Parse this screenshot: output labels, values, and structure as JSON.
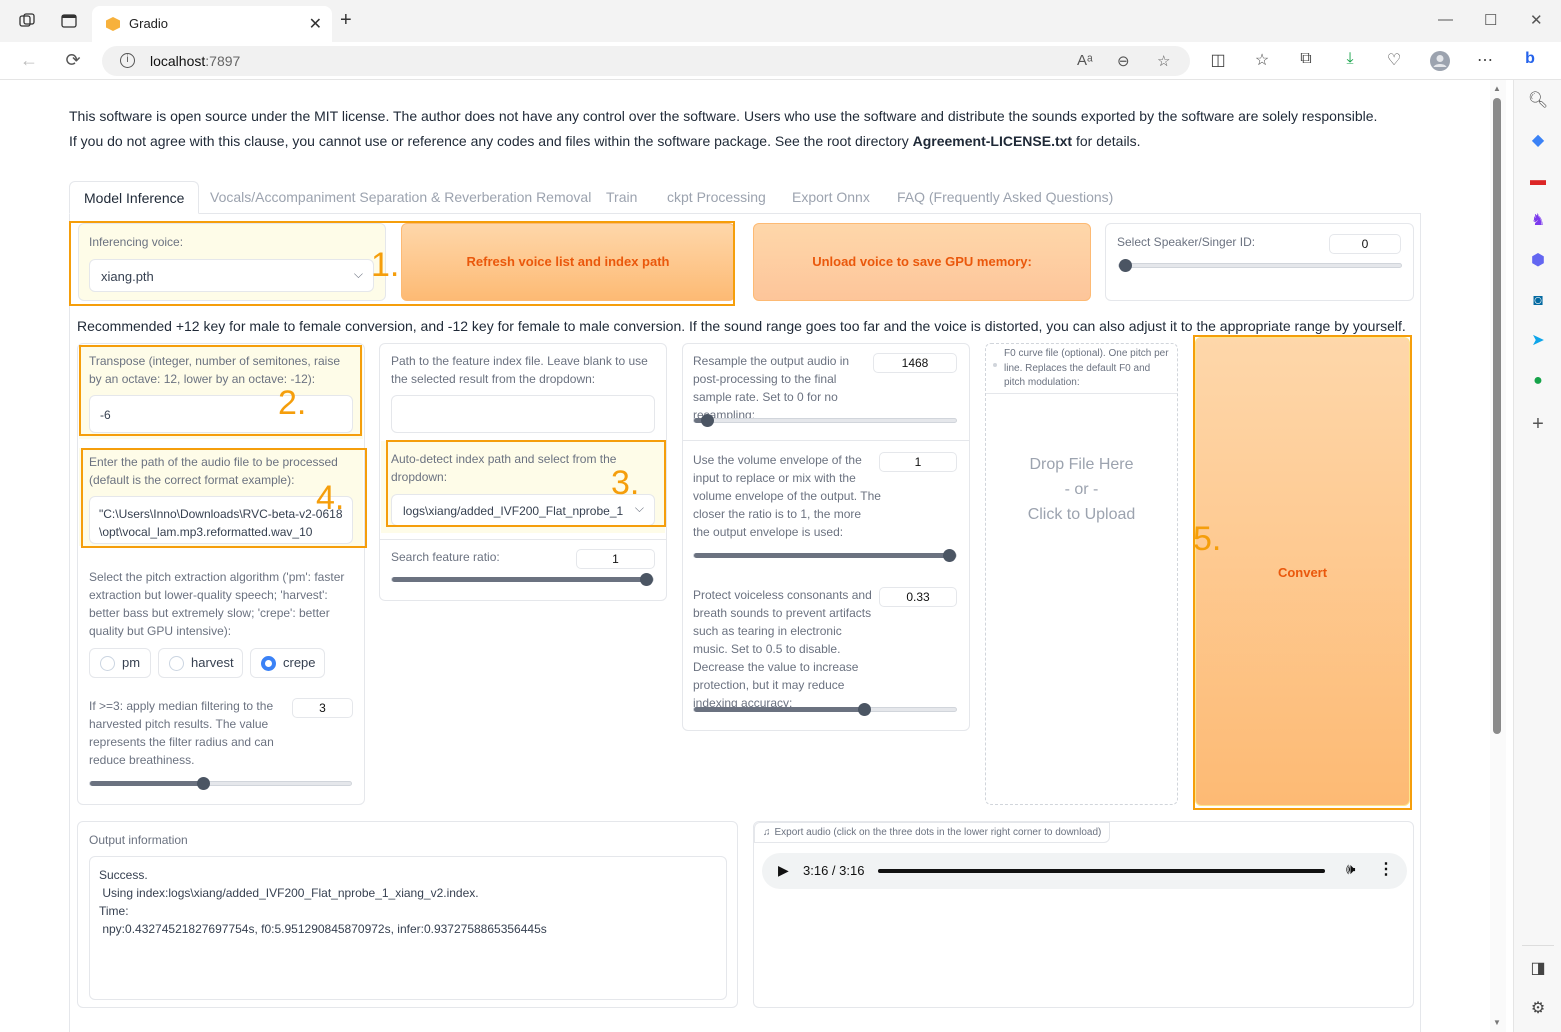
{
  "browser": {
    "tab_title": "Gradio",
    "url_host": "localhost",
    "url_port": ":7897"
  },
  "notice": {
    "line1": "This software is open source under the MIT license. The author does not have any control over the software. Users who use the software and distribute the sounds exported by the software are solely responsible.",
    "line2_pre": "If you do not agree with this clause, you cannot use or reference any codes and files within the software package. See the root directory ",
    "line2_bold": "Agreement-LICENSE.txt",
    "line2_post": " for details."
  },
  "tabs": [
    "Model Inference",
    "Vocals/Accompaniment Separation & Reverberation Removal",
    "Train",
    "ckpt Processing",
    "Export Onnx",
    "FAQ (Frequently Asked Questions)"
  ],
  "voice": {
    "label": "Inferencing voice:",
    "value": "xiang.pth",
    "refresh_button": "Refresh voice list and index path",
    "unload_button": "Unload voice to save GPU memory:",
    "speaker_label": "Select Speaker/Singer ID:",
    "speaker_value": "0",
    "speaker_fraction": 0
  },
  "recommend": "Recommended +12 key for male to female conversion, and -12 key for female to male conversion. If the sound range goes too far and the voice is distorted, you can also adjust it to the appropriate range by yourself.",
  "transpose": {
    "label": "Transpose (integer, number of semitones, raise by an octave: 12, lower by an octave: -12):",
    "value": "-6"
  },
  "audio_path": {
    "label": "Enter the path of the audio file to be processed (default is the correct format example):",
    "value": "\"C:\\Users\\Inno\\Downloads\\RVC-beta-v2-0618\\opt\\vocal_lam.mp3.reformatted.wav_10"
  },
  "pitch": {
    "label": "Select the pitch extraction algorithm ('pm': faster extraction but lower-quality speech; 'harvest': better bass but extremely slow; 'crepe': better quality but GPU intensive):",
    "options": [
      "pm",
      "harvest",
      "crepe"
    ],
    "selected": "crepe"
  },
  "median": {
    "label": "If >=3: apply median filtering to the harvested pitch results. The value represents the filter radius and can reduce breathiness.",
    "value": "3",
    "fraction": 0.43
  },
  "index": {
    "path_label": "Path to the feature index file. Leave blank to use the selected result from the dropdown:",
    "path_value": "",
    "auto_label": "Auto-detect index path and select from the dropdown:",
    "auto_value": "logs\\xiang/added_IVF200_Flat_nprobe_1",
    "ratio_label": "Search feature ratio:",
    "ratio_value": "1",
    "ratio_fraction": 1
  },
  "resample": {
    "label": "Resample the output audio in post-processing to the final sample rate. Set to 0 for no resampling:",
    "value": "1468",
    "fraction": 0.03
  },
  "envelope": {
    "label": "Use the volume envelope of the input to replace or mix with the volume envelope of the output. The closer the ratio is to 1, the more the output envelope is used:",
    "value": "1",
    "fraction": 1
  },
  "protect": {
    "label": "Protect voiceless consonants and breath sounds to prevent artifacts such as tearing in electronic music. Set to 0.5 to disable. Decrease the value to increase protection, but it may reduce indexing accuracy:",
    "value": "0.33",
    "fraction": 0.66
  },
  "f0": {
    "label": "F0 curve file (optional). One pitch per line. Replaces the default F0 and pitch modulation:",
    "drop1": "Drop File Here",
    "drop2": "- or -",
    "drop3": "Click to Upload"
  },
  "convert_button": "Convert",
  "output": {
    "label": "Output information",
    "l1": "Success.",
    "l2": " Using index:logs\\xiang/added_IVF200_Flat_nprobe_1_xiang_v2.index.",
    "l3": "Time:",
    "l4": " npy:0.43274521827697754s, f0:5.951290845870972s, infer:0.9372758865356445s"
  },
  "export_audio": {
    "label": "Export audio (click on the three dots in the lower right corner to download)",
    "time": "3:16 / 3:16",
    "progress": 1
  },
  "annotations": [
    "1.",
    "2.",
    "3.",
    "4.",
    "5."
  ],
  "colors": {
    "accent": "#ea580c",
    "highlight": "#f59e0b",
    "radio_selected": "#3b82f6"
  }
}
